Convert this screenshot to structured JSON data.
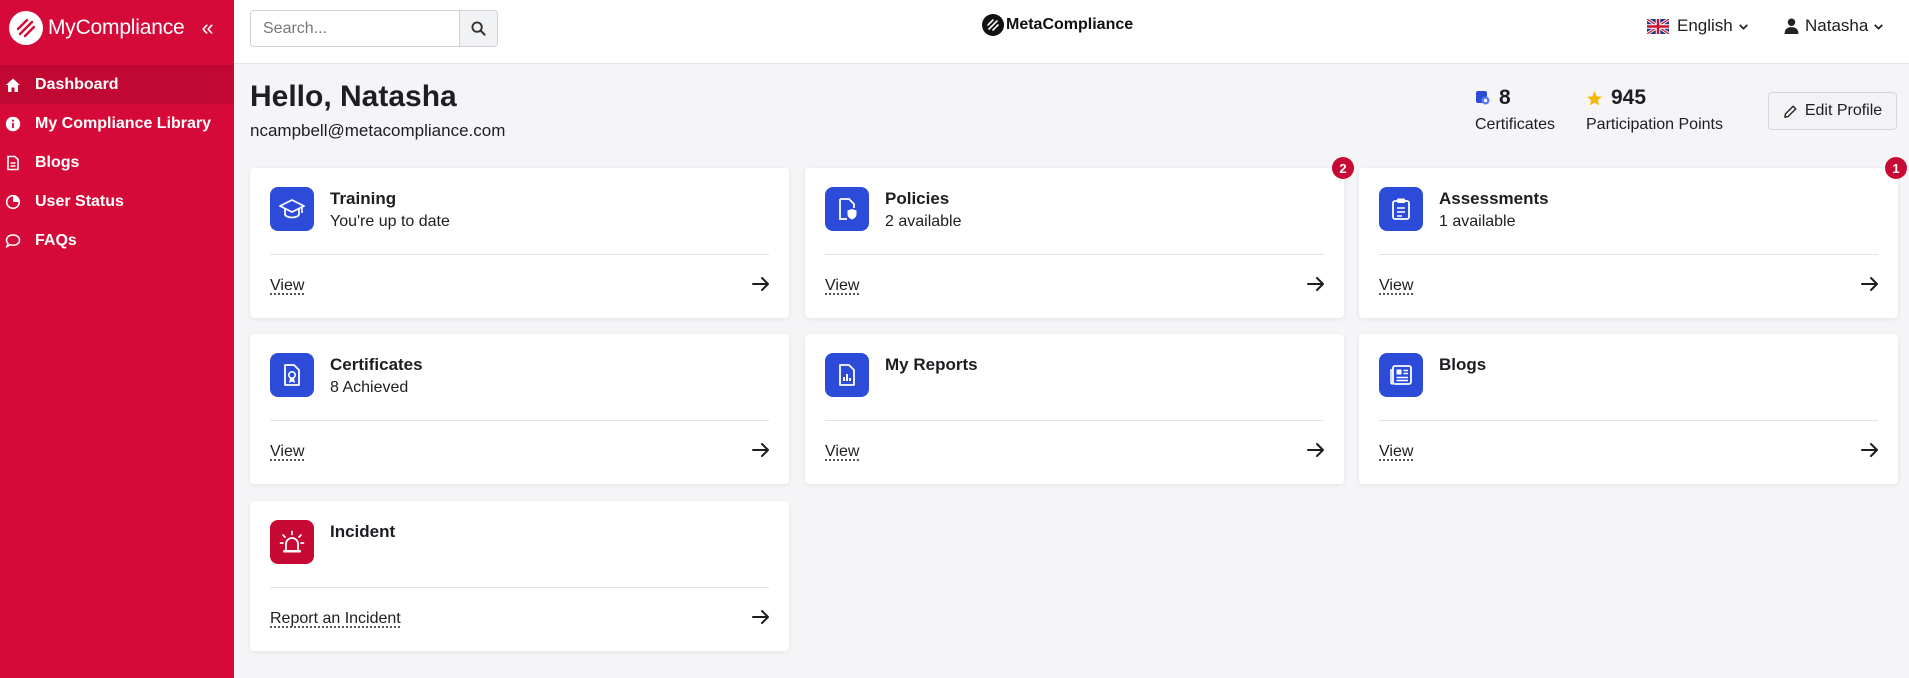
{
  "sidebar": {
    "app_name": "MyCompliance",
    "items": [
      {
        "label": "Dashboard",
        "icon": "home-icon"
      },
      {
        "label": "My Compliance Library",
        "icon": "info-icon"
      },
      {
        "label": "Blogs",
        "icon": "document-icon"
      },
      {
        "label": "User Status",
        "icon": "pie-chart-icon"
      },
      {
        "label": "FAQs",
        "icon": "chat-bubble-icon"
      }
    ],
    "active": "Dashboard"
  },
  "topbar": {
    "search_placeholder": "Search...",
    "center_logo": "MetaCompliance",
    "language": "English",
    "user": "Natasha"
  },
  "greeting": {
    "title": "Hello, Natasha",
    "email": "ncampbell@metacompliance.com"
  },
  "stats": {
    "certificates_value": "8",
    "certificates_label": "Certificates",
    "points_value": "945",
    "points_label": "Participation Points",
    "edit_profile": "Edit Profile"
  },
  "cards": {
    "training": {
      "title": "Training",
      "subtitle": "You're up to date",
      "link": "View"
    },
    "policies": {
      "title": "Policies",
      "subtitle": "2 available",
      "link": "View",
      "badge": "2"
    },
    "assessments": {
      "title": "Assessments",
      "subtitle": "1 available",
      "link": "View",
      "badge": "1"
    },
    "certificates": {
      "title": "Certificates",
      "subtitle": "8 Achieved",
      "link": "View"
    },
    "reports": {
      "title": "My Reports",
      "link": "View"
    },
    "blogs": {
      "title": "Blogs",
      "link": "View"
    },
    "incident": {
      "title": "Incident",
      "link": "Report an Incident"
    }
  },
  "colors": {
    "brand": "#d50a38",
    "accent": "#2b4bd8",
    "badge": "#c70a33"
  }
}
